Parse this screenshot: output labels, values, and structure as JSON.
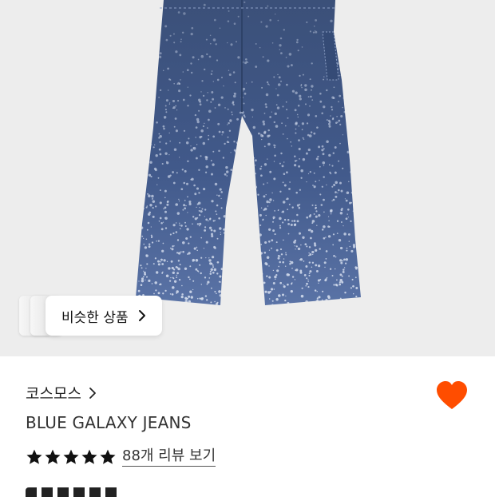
{
  "product": {
    "similar_products_label": "비슷한 상품",
    "brand_name": "코스모스",
    "name": "BLUE GALAXY JEANS",
    "rating_stars": 5,
    "review_link_label": "88개 리뷰 보기",
    "wishlisted": true
  },
  "colors": {
    "heart": "#ff4d00",
    "denim_dark": "#3e5680",
    "denim_light": "#cfd8ea",
    "background": "#ededed"
  },
  "icons": {
    "similar_chevron": "chevron-right-icon",
    "brand_chevron": "chevron-right-icon",
    "wishlist": "heart-filled-icon",
    "star": "star-filled-icon"
  }
}
